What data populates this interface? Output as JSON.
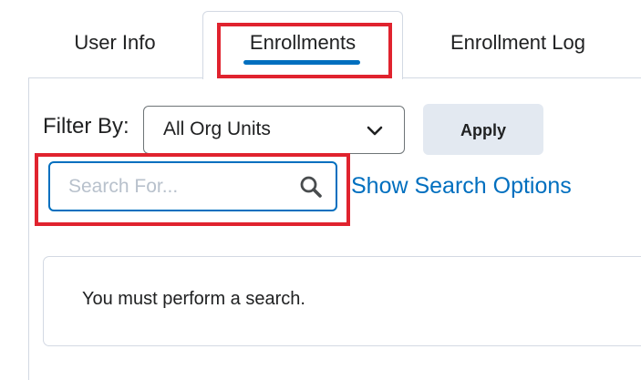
{
  "tabs": [
    {
      "label": "User Info",
      "active": false
    },
    {
      "label": "Enrollments",
      "active": true
    },
    {
      "label": "Enrollment Log",
      "active": false
    }
  ],
  "filter": {
    "label": "Filter By:",
    "selected": "All Org Units",
    "apply_label": "Apply"
  },
  "search": {
    "placeholder": "Search For...",
    "value": "",
    "icon": "search-icon",
    "options_link": "Show Search Options"
  },
  "message": {
    "text": "You must perform a search."
  },
  "colors": {
    "accent": "#006fbf",
    "highlight": "#e0232e",
    "button_bg": "#e3e9f1",
    "border": "#d3d9e3"
  }
}
